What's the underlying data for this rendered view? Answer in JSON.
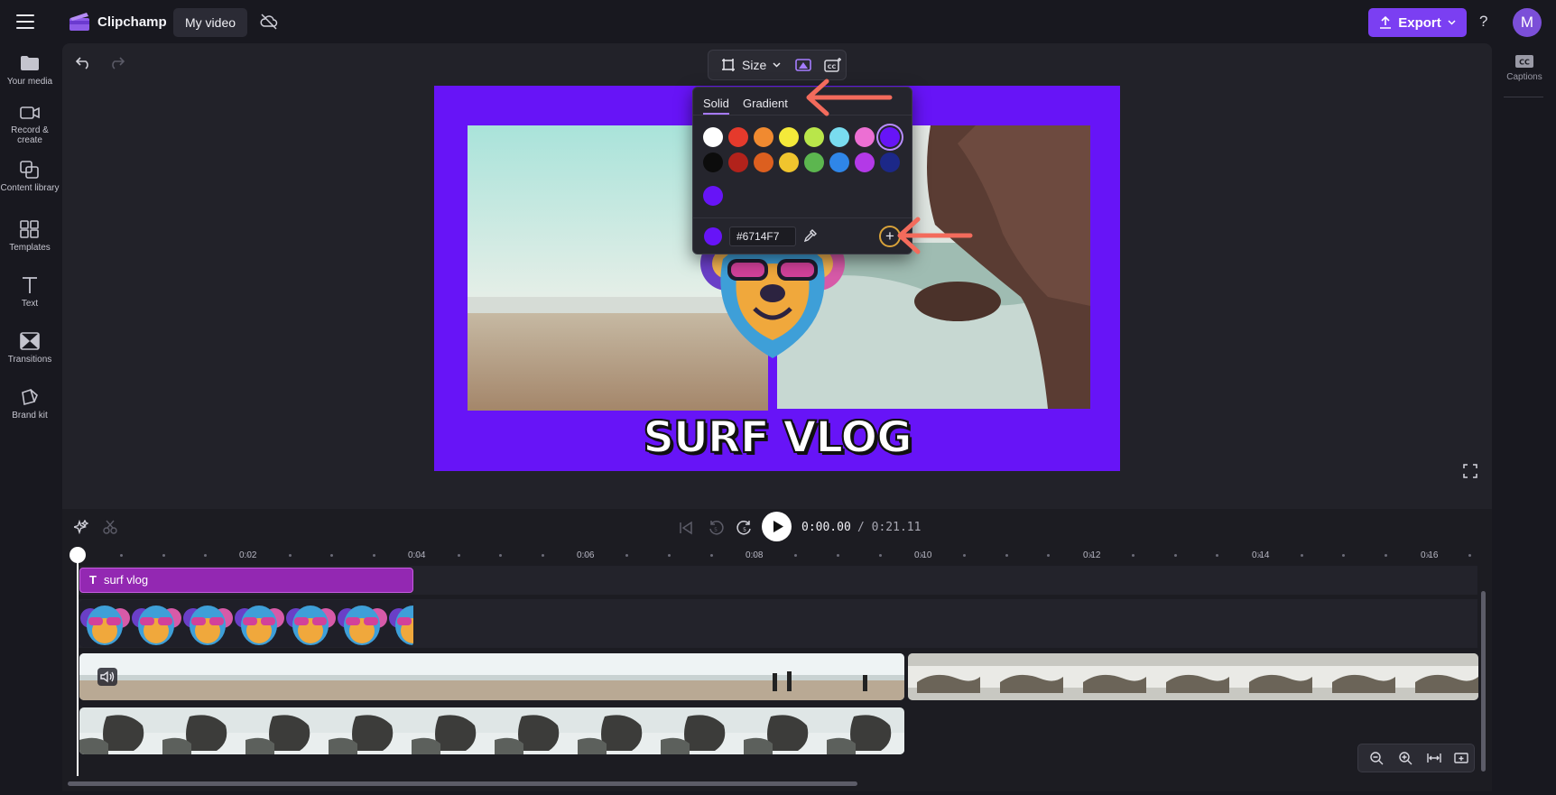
{
  "app": {
    "name": "Clipchamp",
    "project_title": "My video",
    "avatar_initial": "M"
  },
  "header": {
    "export_label": "Export",
    "help_label": "?"
  },
  "sidebar": {
    "items": [
      {
        "label": "Your media",
        "icon": "folder-icon"
      },
      {
        "label": "Record & create",
        "icon": "camera-icon"
      },
      {
        "label": "Content library",
        "icon": "library-icon"
      },
      {
        "label": "Templates",
        "icon": "templates-icon"
      },
      {
        "label": "Text",
        "icon": "text-icon"
      },
      {
        "label": "Transitions",
        "icon": "transitions-icon"
      },
      {
        "label": "Brand kit",
        "icon": "brand-kit-icon"
      }
    ]
  },
  "right_rail": {
    "captions_label": "Captions",
    "captions_icon": "CC"
  },
  "toolbar": {
    "size_label": "Size"
  },
  "preview": {
    "title_text": "SURF VLOG",
    "background_color": "#6714f7"
  },
  "color_picker": {
    "tabs": [
      "Solid",
      "Gradient"
    ],
    "active_tab": "Solid",
    "swatches_row1": [
      "#ffffff",
      "#e53a2c",
      "#f08a30",
      "#f4e93a",
      "#b9e64a",
      "#79dcef",
      "#ec6fd3",
      "#6714f7"
    ],
    "swatches_row2": [
      "#0c0c0c",
      "#b2221b",
      "#dc5f1f",
      "#f0c52e",
      "#5cb64f",
      "#2f86e8",
      "#b339e7",
      "#1c2888"
    ],
    "custom_swatches": [
      "#6714f7"
    ],
    "hex_value": "#6714F7",
    "add_label": "+"
  },
  "playback": {
    "current_time": "0:00.00",
    "total_time": "/ 0:21.11"
  },
  "ruler": {
    "labels": [
      "0:02",
      "0:04",
      "0:06",
      "0:08",
      "0:10",
      "0:12",
      "0:14",
      "0:16"
    ]
  },
  "timeline": {
    "text_clip_label": "surf vlog",
    "text_clip_icon": "T"
  }
}
